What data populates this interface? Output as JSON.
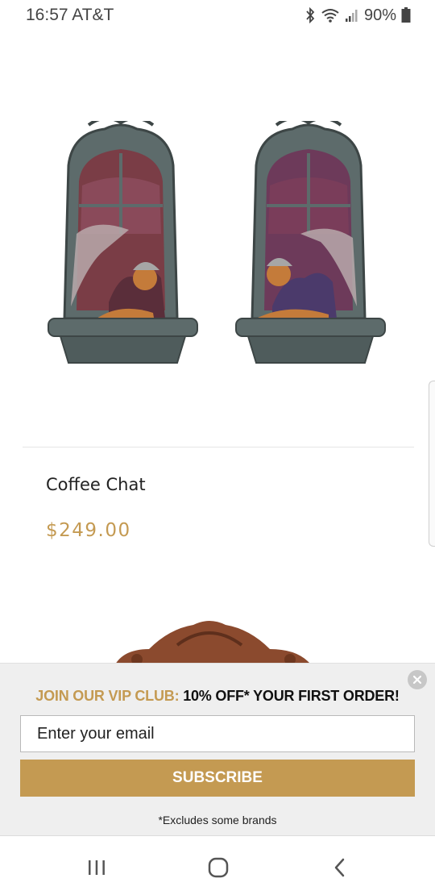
{
  "status_bar": {
    "time": "16:57",
    "carrier": "AT&T",
    "battery": "90%",
    "icons": [
      "bluetooth-icon",
      "wifi-icon",
      "signal-icon",
      "battery-icon"
    ]
  },
  "product": {
    "name": "Coffee Chat",
    "price": "$249.00"
  },
  "popup": {
    "headline_gold": "JOIN OUR VIP CLUB:",
    "headline_dark": "10% OFF* YOUR FIRST ORDER!",
    "email_placeholder": "Enter your email",
    "subscribe_label": "SUBSCRIBE",
    "footnote": "*Excludes some brands",
    "close_icon": "close-icon"
  },
  "nav_bar": {
    "icons": [
      "recent-apps-icon",
      "home-icon",
      "back-icon"
    ]
  },
  "colors": {
    "accent_gold": "#c49a52",
    "popup_bg": "#efefef"
  }
}
